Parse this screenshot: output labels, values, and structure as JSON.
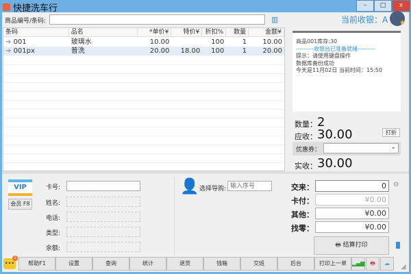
{
  "window": {
    "title": "快捷洗车行",
    "minimize": "–",
    "maximize": "□",
    "close": "x"
  },
  "search": {
    "label": "商品编号/条码:",
    "value": ""
  },
  "table": {
    "headers": [
      "条码",
      "品名",
      "*单价¥",
      "特价¥",
      "折扣%",
      "数量",
      "金额¥"
    ],
    "rows": [
      [
        "001",
        "玻璃水",
        "10.00",
        "",
        "100",
        "1",
        "10.00"
      ],
      [
        "001px",
        "普洗",
        "20.00",
        "18.00",
        "100",
        "1",
        "20.00"
      ]
    ]
  },
  "cashier": {
    "label": "当前收银：A"
  },
  "receipt": {
    "lines": [
      "商品001库存:30",
      "---------收银台已准备就绪---------",
      "提示：请使用键盘操作",
      "数据库备份成功",
      "今天是11月02日 当前时间：15:50"
    ]
  },
  "summary": {
    "qty_label": "数量：",
    "qty": "2",
    "due_label": "应收：",
    "due": "30.00",
    "discount_button": "打折",
    "coupon_label": "优惠券：",
    "coupon_value": "",
    "paid_label": "实收：",
    "paid": "30.00"
  },
  "member": {
    "vip": "VIP",
    "button": "会员 F8",
    "card_label": "卡号:",
    "name_label": "姓名:",
    "phone_label": "电话:",
    "type_label": "类型:",
    "balance_label": "余额:",
    "card_value": ""
  },
  "guide": {
    "label": "选择导购:",
    "placeholder": "输入序号"
  },
  "payment": {
    "tendered_label": "交来：",
    "tendered": "0",
    "card_label": "卡付：",
    "card": "¥0.00",
    "other_label": "其他：",
    "other": "¥0.00",
    "change_label": "找零：",
    "change": "¥0.00",
    "checkout": "结算打印"
  },
  "toolbar": {
    "badge": "1",
    "buttons": [
      "帮助F1",
      "设置",
      "查询",
      "统计",
      "退货",
      "钱箱",
      "交班",
      "后台",
      "打印上一单"
    ]
  },
  "colors": {
    "accent": "#2e8fd8",
    "title": "#6eb0e4"
  }
}
